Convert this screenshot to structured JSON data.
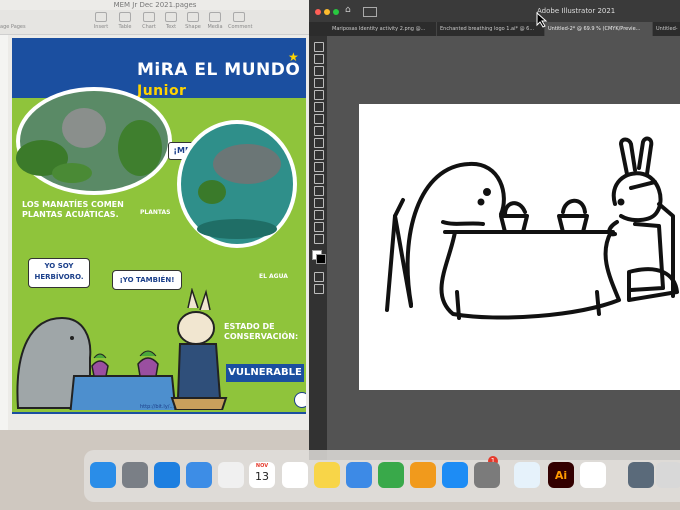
{
  "pages": {
    "window_title": "MEM Jr Dec 2021.pages",
    "toolbar": [
      {
        "label": "Insert",
        "icon": "insert-icon"
      },
      {
        "label": "Table",
        "icon": "table-icon"
      },
      {
        "label": "Chart",
        "icon": "chart-icon"
      },
      {
        "label": "Text",
        "icon": "text-icon"
      },
      {
        "label": "Shape",
        "icon": "shape-icon"
      },
      {
        "label": "Media",
        "icon": "media-icon"
      },
      {
        "label": "Comment",
        "icon": "comment-icon"
      }
    ],
    "sidebar_label": "age Pages",
    "document": {
      "title": "MiRA EL MUNDO",
      "title_sub": "Junior",
      "bubble_mmm": "¡MMM!",
      "caption_manatees": "LOS MANATÍES COMEN\nPLANTAS ACUÁTICAS.",
      "label_plantas": "PLANTAS",
      "label_agua": "EL AGUA",
      "bubble_herbivoro": "YO SOY\nHERBÍVORO.",
      "bubble_tambien": "¡YO TAMBIÉN!",
      "estado_label": "ESTADO DE\nCONSERVACIÓN:",
      "estado_value": "VULNERABLE",
      "footer_url": "http://bit.ly/..."
    }
  },
  "illustrator": {
    "app_title": "Adobe Illustrator 2021",
    "tabs": [
      {
        "label": "Mariposas Identity activity 2.png @...",
        "active": false
      },
      {
        "label": "Enchanted breathing logo 1.ai* @ 6...",
        "active": false
      },
      {
        "label": "Untitled-2* @ 69.9 % (CMYK/Previe...",
        "active": true
      },
      {
        "label": "Untitled-",
        "active": false
      }
    ]
  },
  "dock": {
    "calendar_month": "NOV",
    "calendar_day": "13",
    "settings_badge": "1",
    "apps": [
      {
        "name": "finder-icon",
        "color": "#2a8de8"
      },
      {
        "name": "launchpad-icon",
        "color": "#7a7f86"
      },
      {
        "name": "safari-icon",
        "color": "#1d7fe0"
      },
      {
        "name": "mail-icon",
        "color": "#3d8de6"
      },
      {
        "name": "photos-icon",
        "color": "#f0f0f0"
      },
      {
        "name": "calendar-icon",
        "color": "#ffffff"
      },
      {
        "name": "reminders-icon",
        "color": "#ffffff"
      },
      {
        "name": "notes-icon",
        "color": "#f8d548"
      },
      {
        "name": "keynote-icon",
        "color": "#3d8ae6"
      },
      {
        "name": "numbers-icon",
        "color": "#39a94a"
      },
      {
        "name": "pages-icon",
        "color": "#f19a1c"
      },
      {
        "name": "app-store-icon",
        "color": "#1d8cf5"
      },
      {
        "name": "system-preferences-icon",
        "color": "#7b7b7b"
      },
      {
        "name": "word-icon",
        "color": "#e6f2fb"
      },
      {
        "name": "illustrator-icon",
        "color": "#330000"
      },
      {
        "name": "chrome-icon",
        "color": "#ffffff"
      },
      {
        "name": "document-icon",
        "color": "#5a6a7a"
      },
      {
        "name": "trash-icon",
        "color": "#d8d8d8"
      }
    ]
  }
}
